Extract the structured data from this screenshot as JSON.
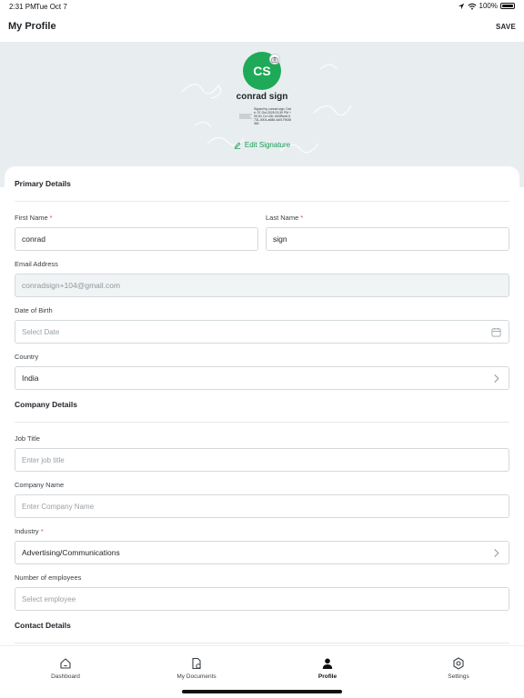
{
  "status_bar": {
    "time": "2:31 PM",
    "date": "Tue Oct 7",
    "battery": "100%"
  },
  "nav": {
    "title": "My Profile",
    "save_label": "SAVE"
  },
  "profile": {
    "initials": "CS",
    "display_name": "conrad sign",
    "signature_text": "Signed by conrad sign. Date: 07-Oct-2025 02:30 PM +05:30, Dv UID: b63f9ce6-5731-4004-a688-4a0179635382",
    "edit_signature_label": "Edit Signature",
    "accent_color": "#1eaa58"
  },
  "primary": {
    "title": "Primary Details",
    "first_name_label": "First Name",
    "first_name_value": "conrad",
    "last_name_label": "Last Name",
    "last_name_value": "sign",
    "email_label": "Email Address",
    "email_value": "conradsign+104@gmail.com",
    "dob_label": "Date of Birth",
    "dob_placeholder": "Select Date",
    "country_label": "Country",
    "country_value": "India"
  },
  "company": {
    "title": "Company Details",
    "job_title_label": "Job Title",
    "job_title_placeholder": "Enter job title",
    "company_name_label": "Company Name",
    "company_name_placeholder": "Enter Company Name",
    "industry_label": "Industry",
    "industry_value": "Advertising/Communications",
    "employees_label": "Number of employees",
    "employees_placeholder": "Select employee"
  },
  "contact": {
    "title": "Contact Details"
  },
  "required_marker": "*",
  "tabs": [
    {
      "label": "Dashboard",
      "icon": "home-icon"
    },
    {
      "label": "My Documents",
      "icon": "document-icon"
    },
    {
      "label": "Profile",
      "icon": "user-icon",
      "active": true
    },
    {
      "label": "Settings",
      "icon": "gear-icon"
    }
  ]
}
